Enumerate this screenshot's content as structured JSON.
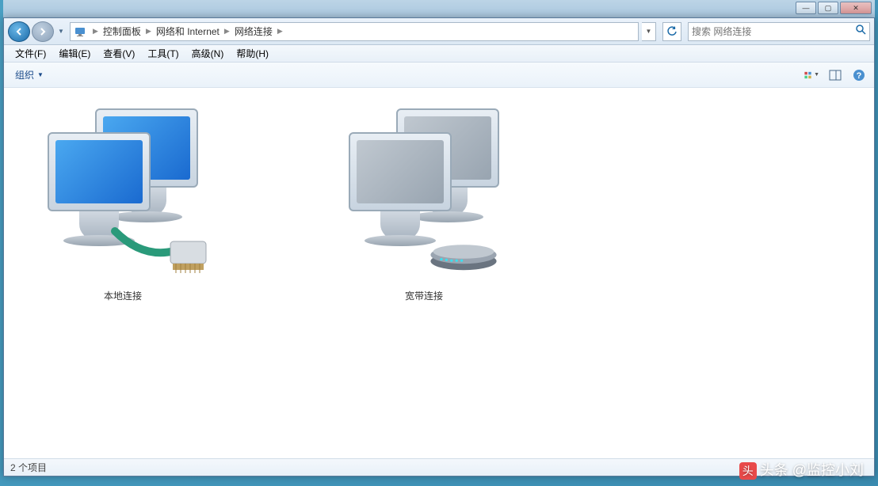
{
  "window_controls": {
    "min": "—",
    "max": "▢",
    "close": "✕"
  },
  "breadcrumb": {
    "segments": [
      "控制面板",
      "网络和 Internet",
      "网络连接"
    ]
  },
  "search": {
    "placeholder": "搜索 网络连接"
  },
  "menubar": {
    "items": [
      "文件(F)",
      "编辑(E)",
      "查看(V)",
      "工具(T)",
      "高级(N)",
      "帮助(H)"
    ]
  },
  "toolbar": {
    "organize": "组织"
  },
  "connections": [
    {
      "label": "本地连接",
      "type": "ethernet",
      "active": true
    },
    {
      "label": "宽带连接",
      "type": "broadband",
      "active": false
    }
  ],
  "statusbar": {
    "text": "2 个项目"
  },
  "watermark": {
    "prefix": "头条",
    "handle": "@监控小刘"
  }
}
